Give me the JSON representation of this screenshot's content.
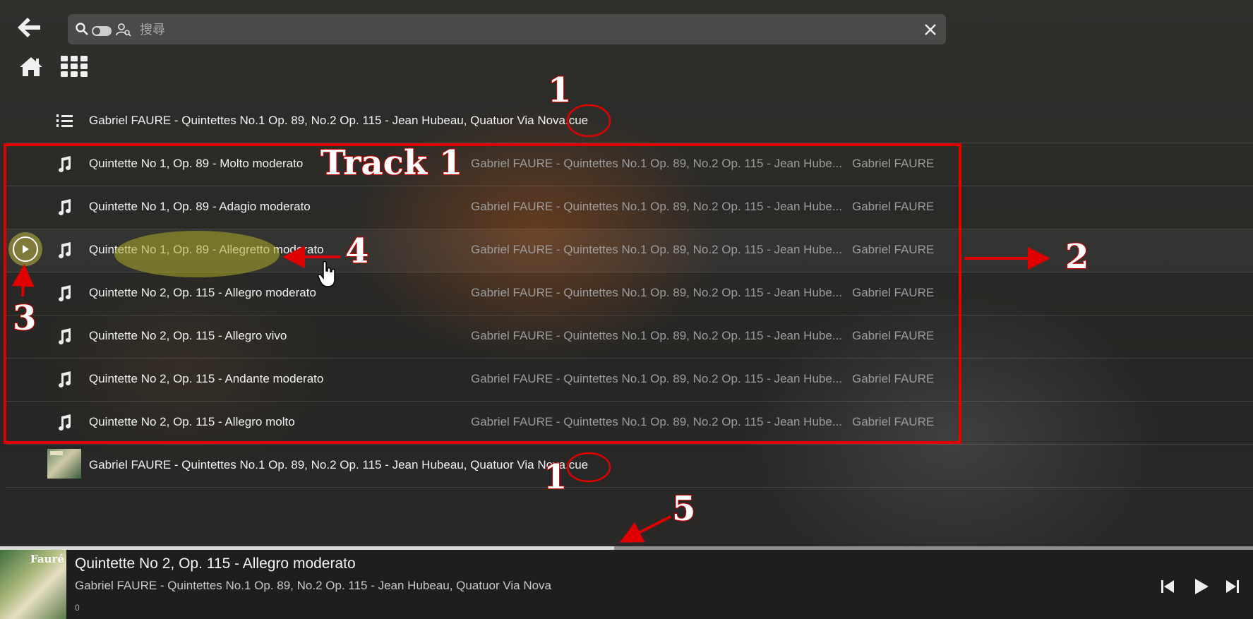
{
  "search": {
    "placeholder": "搜尋"
  },
  "cue_file_name": "Gabriel FAURE - Quintettes No.1 Op. 89, No.2 Op. 115 - Jean Hubeau, Quatuor Via Nova.cue",
  "tracks": [
    {
      "title": "Quintette No 1, Op. 89 - Molto moderato",
      "album": "Gabriel FAURE - Quintettes No.1 Op. 89, No.2 Op. 115 - Jean Hube...",
      "artist": "Gabriel FAURE"
    },
    {
      "title": "Quintette No 1, Op. 89 - Adagio moderato",
      "album": "Gabriel FAURE - Quintettes No.1 Op. 89, No.2 Op. 115 - Jean Hube...",
      "artist": "Gabriel FAURE"
    },
    {
      "title": "Quintette No 1, Op. 89 - Allegretto moderato",
      "album": "Gabriel FAURE - Quintettes No.1 Op. 89, No.2 Op. 115 - Jean Hube...",
      "artist": "Gabriel FAURE"
    },
    {
      "title": "Quintette No 2, Op. 115 - Allegro moderato",
      "album": "Gabriel FAURE - Quintettes No.1 Op. 89, No.2 Op. 115 - Jean Hube...",
      "artist": "Gabriel FAURE"
    },
    {
      "title": "Quintette No 2, Op. 115 - Allegro vivo",
      "album": "Gabriel FAURE - Quintettes No.1 Op. 89, No.2 Op. 115 - Jean Hube...",
      "artist": "Gabriel FAURE"
    },
    {
      "title": "Quintette No 2, Op. 115 - Andante moderato",
      "album": "Gabriel FAURE - Quintettes No.1 Op. 89, No.2 Op. 115 - Jean Hube...",
      "artist": "Gabriel FAURE"
    },
    {
      "title": "Quintette No 2, Op. 115 - Allegro molto",
      "album": "Gabriel FAURE - Quintettes No.1 Op. 89, No.2 Op. 115 - Jean Hube...",
      "artist": "Gabriel FAURE"
    }
  ],
  "annotations": {
    "track_label": "Track 1",
    "n1": "1",
    "n2": "2",
    "n3": "3",
    "n4": "4",
    "n5": "5"
  },
  "player": {
    "cover_text": "Fauré",
    "title": "Quintette No 2, Op. 115 - Allegro moderato",
    "album": "Gabriel FAURE - Quintettes No.1 Op. 89, No.2 Op. 115 - Jean Hubeau, Quatuor Via Nova",
    "time": "0",
    "progress_percent": 49
  },
  "icons": {
    "back": "arrow-left-icon",
    "home": "home-icon",
    "grid": "grid-icon",
    "search": "search-icon",
    "clear": "close-icon",
    "playlist": "playlist-icon",
    "note": "music-note-icon"
  },
  "colors": {
    "annotation_red": "#e00000",
    "highlight_yellow": "#b4aa3c"
  }
}
